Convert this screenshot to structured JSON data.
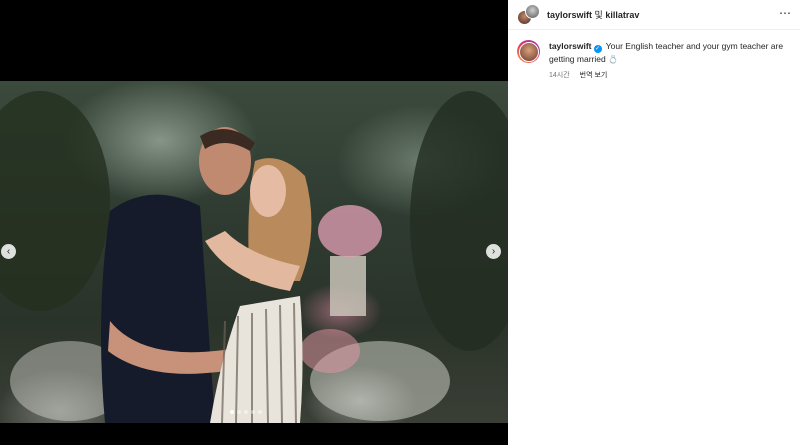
{
  "post": {
    "header": {
      "user1": "taylorswift",
      "conjunction": "및",
      "user2": "killatrav",
      "more_icon": "⋯"
    },
    "caption": {
      "username": "taylorswift",
      "text": "Your English teacher and your gym teacher are getting married",
      "emoji": "💍"
    },
    "time": "14시간",
    "translate": "번역 보기"
  },
  "media": {
    "prev_icon": "‹",
    "next_icon": "›",
    "carousel_current_index": 1,
    "carousel_total": 5
  },
  "colors": {
    "verified": "#0095f6",
    "panel_bg": "#ffffff",
    "media_bg": "#000000"
  }
}
